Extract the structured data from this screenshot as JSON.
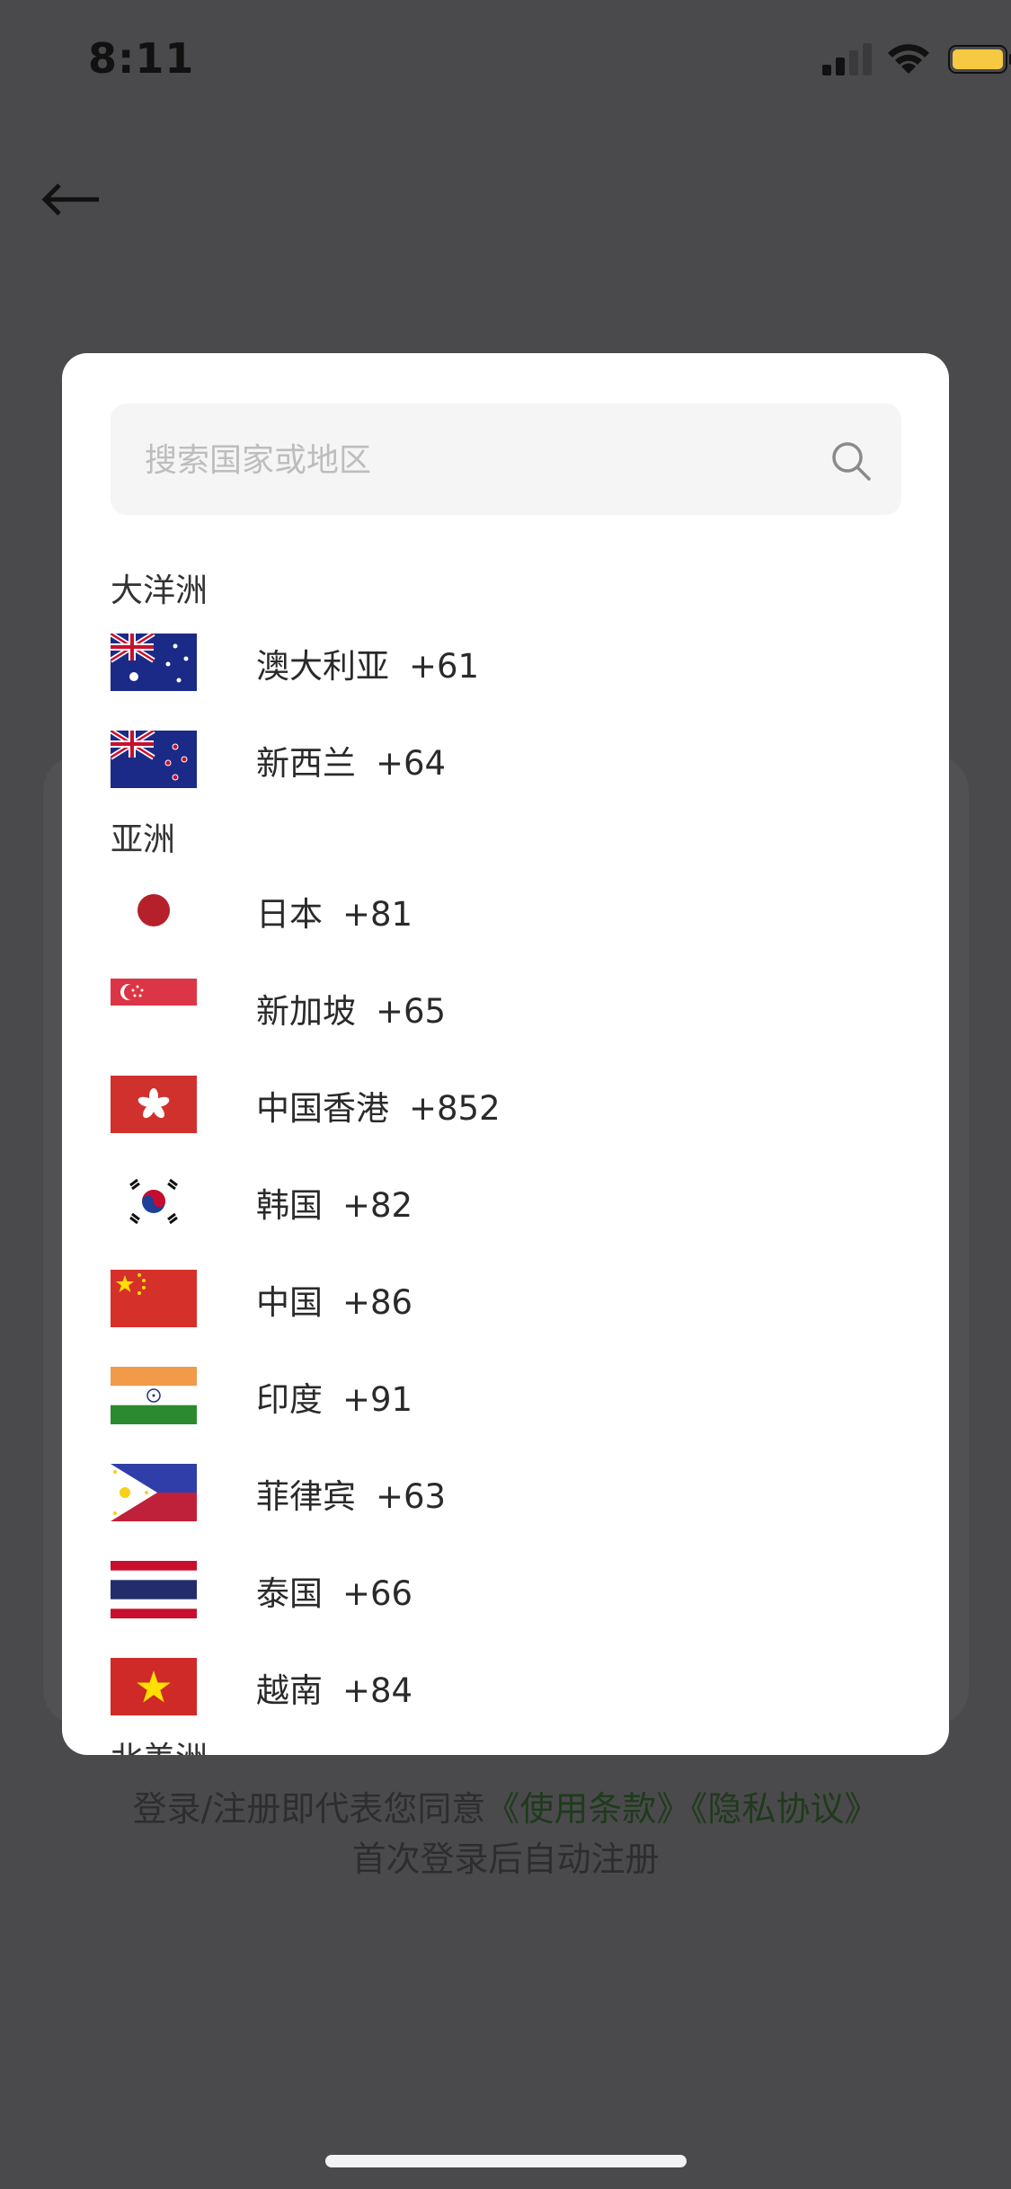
{
  "status_bar": {
    "time": "8:11"
  },
  "search": {
    "placeholder": "搜索国家或地区"
  },
  "sections": [
    {
      "title": "大洋洲",
      "countries": [
        {
          "name": "澳大利亚",
          "code": "+61",
          "flag": "australia-flag"
        },
        {
          "name": "新西兰",
          "code": "+64",
          "flag": "new-zealand-flag"
        }
      ]
    },
    {
      "title": "亚洲",
      "countries": [
        {
          "name": "日本",
          "code": "+81",
          "flag": "japan-flag"
        },
        {
          "name": "新加坡",
          "code": "+65",
          "flag": "singapore-flag"
        },
        {
          "name": "中国香港",
          "code": "+852",
          "flag": "hong-kong-flag"
        },
        {
          "name": "韩国",
          "code": "+82",
          "flag": "south-korea-flag"
        },
        {
          "name": "中国",
          "code": "+86",
          "flag": "china-flag"
        },
        {
          "name": "印度",
          "code": "+91",
          "flag": "india-flag"
        },
        {
          "name": "菲律宾",
          "code": "+63",
          "flag": "philippines-flag"
        },
        {
          "name": "泰国",
          "code": "+66",
          "flag": "thailand-flag"
        },
        {
          "name": "越南",
          "code": "+84",
          "flag": "vietnam-flag"
        }
      ]
    },
    {
      "title": "北美洲",
      "countries": []
    }
  ],
  "footer": {
    "prefix": "登录/注册即代表您同意",
    "terms_link": "《使用条款》",
    "privacy_link": "《隐私协议》",
    "note": "首次登录后自动注册"
  },
  "colors": {
    "overlay": "#4a4a4c",
    "battery": "#f7c842",
    "link": "#1f3a1c"
  }
}
